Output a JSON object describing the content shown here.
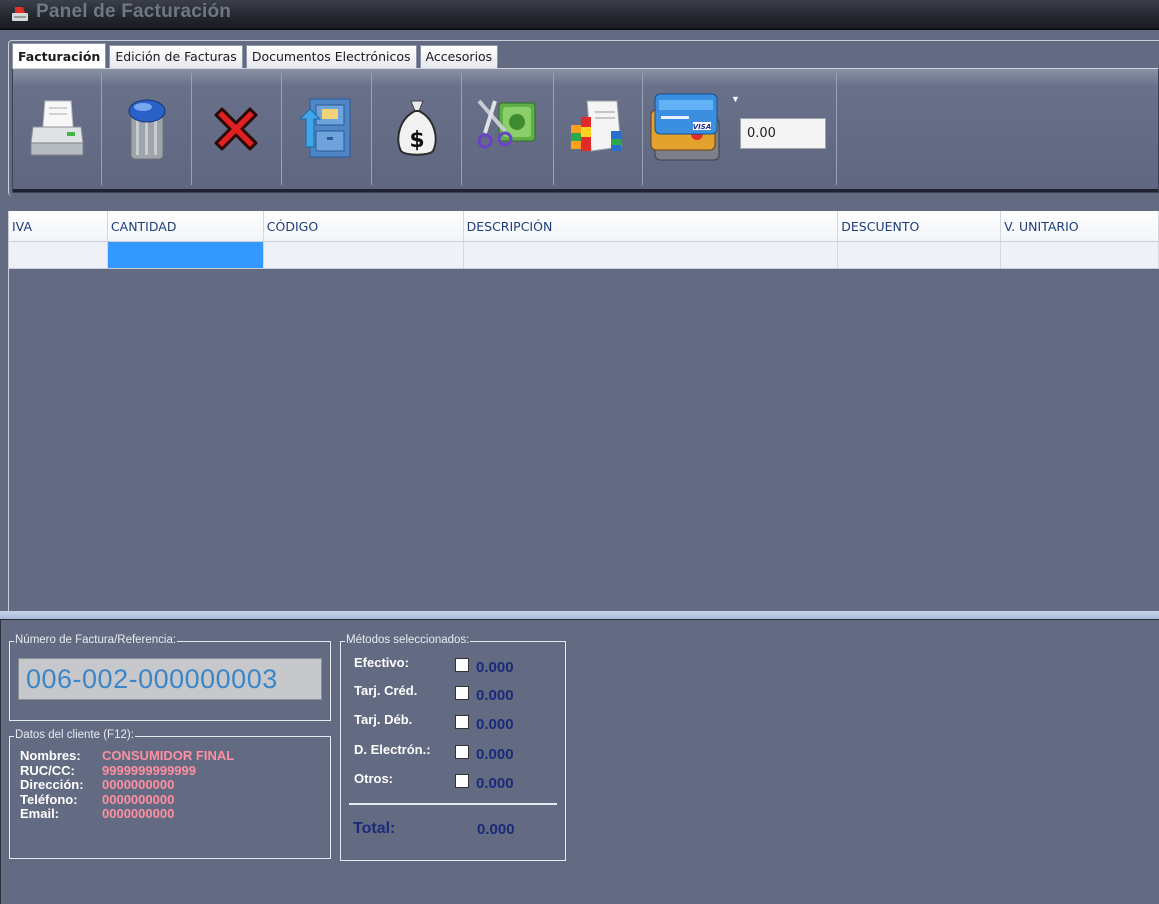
{
  "window": {
    "title": "Panel de Facturación"
  },
  "tabs": [
    {
      "label": "Facturación",
      "active": true
    },
    {
      "label": "Edición de Facturas",
      "active": false
    },
    {
      "label": "Documentos Electrónicos",
      "active": false
    },
    {
      "label": "Accesorios",
      "active": false
    }
  ],
  "toolbar": {
    "buttons": [
      "printer-icon",
      "trash-can-icon",
      "delete-x-icon",
      "file-cabinet-icon",
      "money-bag-icon",
      "cut-money-icon",
      "report-chart-icon",
      "credit-cards-icon"
    ],
    "amount_value": "0.00"
  },
  "grid": {
    "columns": [
      "IVA",
      "CANTIDAD",
      "CÓDIGO",
      "DESCRIPCIÓN",
      "DESCUENTO",
      "V. UNITARIO"
    ],
    "rows": [
      [
        "",
        "",
        "",
        "",
        "",
        ""
      ]
    ]
  },
  "invoice": {
    "legend": "Número de Factura/Referencia:",
    "number": "006-002-000000003"
  },
  "client": {
    "legend": "Datos del cliente (F12):",
    "fields": [
      {
        "label": "Nombres:",
        "value": "CONSUMIDOR FINAL"
      },
      {
        "label": "RUC/CC:",
        "value": "9999999999999"
      },
      {
        "label": "Dirección:",
        "value": "0000000000"
      },
      {
        "label": "Teléfono:",
        "value": "0000000000"
      },
      {
        "label": "Email:",
        "value": "0000000000"
      }
    ]
  },
  "payments": {
    "legend": "Métodos seleccionados:",
    "methods": [
      {
        "label": "Efectivo:",
        "amount": "0.000",
        "checked": false
      },
      {
        "label": "Tarj. Créd.",
        "amount": "0.000",
        "checked": false
      },
      {
        "label": "Tarj. Déb.",
        "amount": "0.000",
        "checked": false
      },
      {
        "label": "D. Electrón.:",
        "amount": "0.000",
        "checked": false
      },
      {
        "label": "Otros:",
        "amount": "0.000",
        "checked": false
      }
    ],
    "total_label": "Total:",
    "total_value": "0.000"
  },
  "colors": {
    "background": "#636b82",
    "selected_cell": "#3399ff",
    "client_value": "#ff8fa0",
    "amount_text": "#1a2a78",
    "invoice_number": "#3c86c8"
  }
}
